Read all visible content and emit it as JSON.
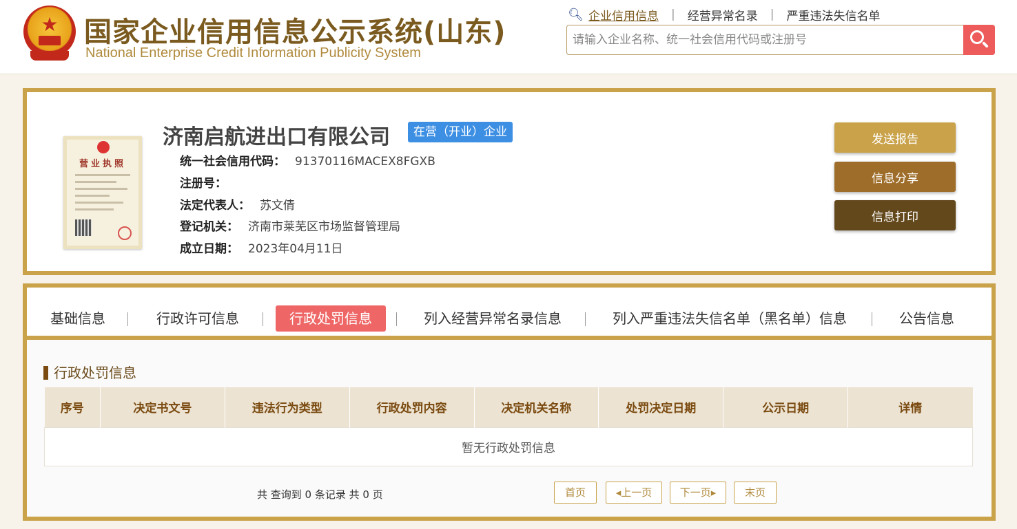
{
  "header": {
    "title_cn": "国家企业信用信息公示系统(山东)",
    "title_en": "National Enterprise Credit Information Publicity System",
    "links": [
      "企业信用信息",
      "经营异常名录",
      "严重违法失信名单"
    ],
    "search_placeholder": "请输入企业名称、统一社会信用代码或注册号"
  },
  "company": {
    "name": "济南启航进出口有限公司",
    "status": "在营（开业）企业",
    "license_title": "营业执照",
    "fields": [
      {
        "key": "统一社会信用代码：",
        "value": "91370116MACEX8FGXB"
      },
      {
        "key": "注册号：",
        "value": ""
      },
      {
        "key": "法定代表人：",
        "value": "苏文倩"
      },
      {
        "key": "登记机关：",
        "value": "济南市莱芜区市场监督管理局"
      },
      {
        "key": "成立日期：",
        "value": "2023年04月11日"
      }
    ]
  },
  "actions": {
    "report": "发送报告",
    "share": "信息分享",
    "print": "信息打印"
  },
  "tabs": [
    "基础信息",
    "行政许可信息",
    "行政处罚信息",
    "列入经营异常名录信息",
    "列入严重违法失信名单（黑名单）信息",
    "公告信息"
  ],
  "active_tab": "行政处罚信息",
  "section": {
    "title": "行政处罚信息",
    "columns": [
      "序号",
      "决定书文号",
      "违法行为类型",
      "行政处罚内容",
      "决定机关名称",
      "处罚决定日期",
      "公示日期",
      "详情"
    ],
    "empty_text": "暂无行政处罚信息"
  },
  "pager": {
    "summary": "共 查询到 0 条记录 共 0 页",
    "first": "首页",
    "prev": "上一页",
    "next": "下一页",
    "last": "末页"
  },
  "colors": {
    "gold": "#c9a24a",
    "brown": "#7a5a1e",
    "active_tab": "#ee6666",
    "badge_blue": "#3d8fe3",
    "search_btn": "#ee5b5b"
  }
}
